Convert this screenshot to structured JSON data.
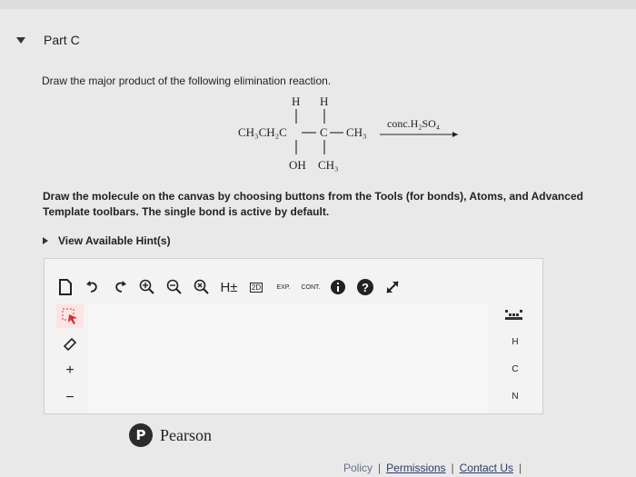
{
  "part": {
    "title": "Part C"
  },
  "question": {
    "text": "Draw the major product of the following elimination reaction."
  },
  "reaction": {
    "h_top_left": "H",
    "h_top_right": "H",
    "left_group": "CH₃CH₂C",
    "center_carbon": "C",
    "right_group": "CH₃",
    "oh": "OH",
    "ch3_bottom": "CH₃",
    "reagent": "conc.H₂SO₄"
  },
  "instructions": {
    "text": "Draw the molecule on the canvas by choosing buttons from the Tools (for bonds), Atoms, and Advanced Template toolbars. The single bond is active by default."
  },
  "hint": {
    "label": "View Available Hint(s)"
  },
  "toolbar": {
    "h_plus": "H±",
    "two_d": "2D",
    "exp": "EXP.",
    "cont": "CONT."
  },
  "left_tools": {
    "plus": "+",
    "minus": "−"
  },
  "atoms": {
    "h": "H",
    "c": "C",
    "n": "N"
  },
  "brand": {
    "logo_letter": "P",
    "name": "Pearson"
  },
  "footer": {
    "partial": "Policy",
    "sep1": "|",
    "permissions": "Permissions",
    "sep2": "|",
    "contact": "Contact Us",
    "sep3": "|"
  }
}
